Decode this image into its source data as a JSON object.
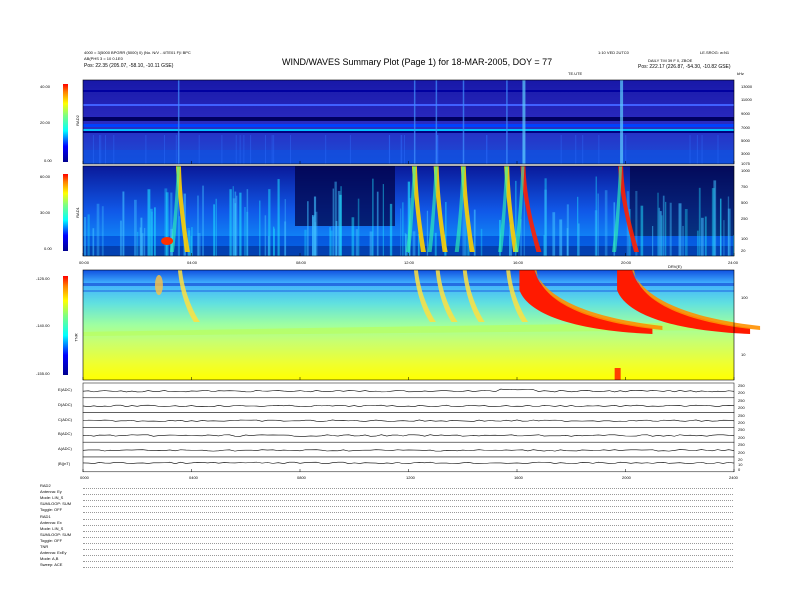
{
  "header": {
    "title": "WIND/WAVES Summary Plot (Page 1) for 18-MAR-2005, DOY = 77",
    "left_line1": "4000 = 3(5000 BPGRR (5000) 0) (No. N/V - 4/TE01 F)I BPC",
    "left_line2": "AB(PHS 3 = 10 0.1E0",
    "left_pos": "Pos: 22.35 (205.07, -58.10, -10.11 GSE)",
    "right_line1": "1:10 VED 2UTC0",
    "right_line2": "LE.SROG: w:N1",
    "right_line3": "DAILY T:M 39 F 0, ZBOE",
    "right_pos": "Pos: 222.17 (226.87, -54.30, -10.82 GSE)",
    "units_top": "TE.UTE",
    "units_right": "kHz",
    "units_mid": "DRV(E)"
  },
  "panels": {
    "rad2": {
      "label": "RAD2",
      "cbar_ticks": [
        "40.00",
        "20.00",
        "0.00"
      ],
      "freq_ticks": [
        "13000",
        "11000",
        "9000",
        "7000",
        "5000",
        "3000",
        "1075"
      ]
    },
    "rad1": {
      "label": "RAD1",
      "cbar_ticks": [
        "60.00",
        "30.00",
        "0.00"
      ],
      "freq_ticks": [
        "1000",
        "750",
        "500",
        "250",
        "100",
        "20"
      ]
    },
    "tnr": {
      "label": "TNR",
      "cbar_ticks": [
        "-125.00",
        "-140.00",
        "-155.00"
      ],
      "freq_ticks": [
        "100",
        "10"
      ]
    }
  },
  "time_ticks": [
    "00:00",
    "04:00",
    "08:00",
    "12:00",
    "16:00",
    "20:00",
    "24:00"
  ],
  "bottom_time_ticks": [
    "0000",
    "0400",
    "0800",
    "1200",
    "1600",
    "2000",
    "2400"
  ],
  "line_panels": [
    {
      "label": "E(ADC)",
      "scale": [
        "250",
        "200"
      ]
    },
    {
      "label": "D(ADC)",
      "scale": [
        "250",
        "200"
      ]
    },
    {
      "label": "C(ADC)",
      "scale": [
        "250",
        "200"
      ]
    },
    {
      "label": "B(ADC)",
      "scale": [
        "250",
        "200"
      ]
    },
    {
      "label": "A(ADC)",
      "scale": [
        "250",
        "200"
      ]
    },
    {
      "label": "|B|(nT)",
      "scale": [
        "20",
        "10",
        "0"
      ]
    }
  ],
  "bottom_block": [
    "RAD2",
    "Antenna: Ey",
    "Mode: LIN_S",
    "SUMLOOP: SUM",
    "Toggle: OFF",
    "RAD1",
    "Antenna: Ex",
    "Mode: LIN_S",
    "SUMLOOP: SUM",
    "Toggle: OFF",
    "TNR",
    "Antenna: ExEy",
    "Mode: A,B",
    "Sweep: ACE"
  ],
  "chart_data": {
    "type": "heatmap",
    "title": "WIND/WAVES Summary Plot (Page 1) for 18-MAR-2005, DOY = 77",
    "x_range_hours": [
      0,
      24
    ],
    "xticks": [
      "00:00",
      "04:00",
      "08:00",
      "12:00",
      "16:00",
      "20:00",
      "24:00"
    ],
    "panels": [
      {
        "name": "RAD2",
        "yaxis": "kHz",
        "ytick_labels": [
          "13000",
          "11000",
          "9000",
          "7000",
          "5000",
          "3000",
          "1075"
        ],
        "color_range": [
          0,
          40
        ]
      },
      {
        "name": "RAD1",
        "yaxis": "kHz",
        "ytick_labels": [
          "1000",
          "750",
          "500",
          "250",
          "100",
          "20"
        ],
        "color_range": [
          0,
          60
        ]
      },
      {
        "name": "TNR",
        "yaxis": "kHz",
        "ytick_labels": [
          "100",
          "10"
        ],
        "color_range": [
          -155,
          -125
        ]
      }
    ],
    "type_III_bursts_hours": [
      3.5,
      12.2,
      13.0,
      14.0,
      15.6,
      16.2,
      19.8
    ],
    "strong_events_hours": [
      16.3,
      19.8
    ],
    "grid": false
  }
}
